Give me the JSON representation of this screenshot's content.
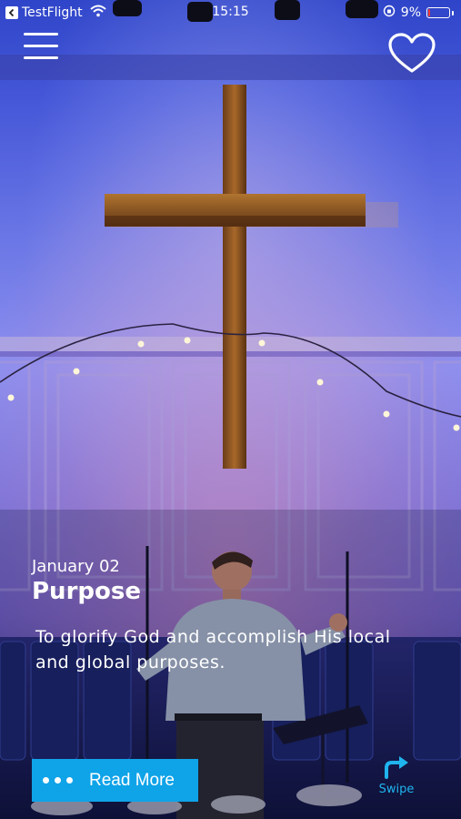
{
  "status_bar": {
    "back_app": "TestFlight",
    "time": "15:15",
    "battery": "9%",
    "battery_level": 0.09,
    "battery_color": "#ff3b30"
  },
  "header": {
    "menu_icon": "hamburger-menu-icon",
    "favorite_icon": "heart-icon"
  },
  "devotion": {
    "date": "January 02",
    "title": "Purpose",
    "description": "To glorify God and accomplish His local and global purposes."
  },
  "actions": {
    "read_more_label": "Read More",
    "read_more_color": "#0fa3e8",
    "swipe_label": "Swipe",
    "swipe_color": "#1fb4ee"
  }
}
